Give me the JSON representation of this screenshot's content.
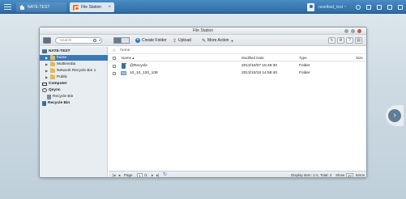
{
  "taskbar": {
    "home_tab_label": "NATE-TEST",
    "active_tab_label": "File Station",
    "user_label": "ravelbud_test ~"
  },
  "window": {
    "title": "File Station"
  },
  "toolbar": {
    "search_placeholder": "Search",
    "create_folder_label": "Create Folder",
    "upload_label": "Upload",
    "more_action_label": "More Action"
  },
  "sidebar": {
    "items": [
      {
        "label": "NATE-TEST"
      },
      {
        "label": "home"
      },
      {
        "label": "Multimedia"
      },
      {
        "label": "Network Recycle Bin 1"
      },
      {
        "label": "Public"
      },
      {
        "label": "Computer"
      },
      {
        "label": "Qsync"
      },
      {
        "label": "Recycle Bin"
      },
      {
        "label": "Recycle Bin"
      }
    ]
  },
  "main": {
    "path_label": "home",
    "columns": {
      "name": "Name",
      "modified": "Modified Date",
      "type": "Type",
      "size": "Size"
    },
    "rows": [
      {
        "name": "@Recycle",
        "modified": "2013/10/07 15:49:30",
        "type": "Folder"
      },
      {
        "name": "10_10_120_108",
        "modified": "2013/10/18 14:58:40",
        "type": "Folder"
      }
    ]
  },
  "footer": {
    "page_label": "Page",
    "page_value": "1",
    "page_total": "/1",
    "display_text": "Display item: 1-2, Total: 2",
    "show_label": "Show",
    "show_value": "20",
    "items_label": "Items"
  },
  "colors": {
    "taskbar": "#2d6aa3",
    "selection": "#3b78b6",
    "accent": "#2b78c2"
  }
}
